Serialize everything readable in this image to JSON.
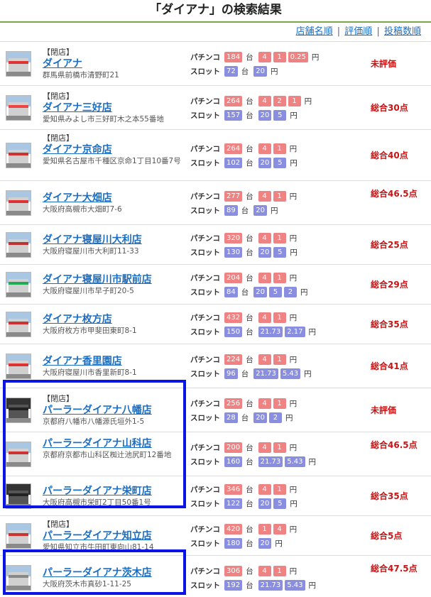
{
  "page_title": "「ダイアナ」の検索結果",
  "sort": {
    "by_name": "店舗名順",
    "by_rating": "評価順",
    "by_posts": "投稿数順",
    "separator": "|"
  },
  "labels": {
    "closed": "【閉店】",
    "pachinko": "パチンコ",
    "slot": "スロット",
    "dai": "台",
    "yen": "円"
  },
  "stores": [
    {
      "closed": true,
      "name": "ダイアナ",
      "address": "群馬県前橋市清野町21",
      "pachinko_count": "184",
      "pachinko_rates": [
        "4",
        "1",
        "0.25"
      ],
      "slot_count": "72",
      "slot_rates": [
        "20"
      ],
      "score": "未評価"
    },
    {
      "closed": true,
      "name": "ダイアナ三好店",
      "address": "愛知県みよし市三好町木之本55番地",
      "pachinko_count": "264",
      "pachinko_rates": [
        "4",
        "2",
        "1"
      ],
      "slot_count": "157",
      "slot_rates": [
        "20",
        "5"
      ],
      "score": "総合30点"
    },
    {
      "closed": true,
      "name": "ダイアナ京命店",
      "address": "愛知県名古屋市千種区京命1丁目10番7号",
      "pachinko_count": "264",
      "pachinko_rates": [
        "4",
        "1"
      ],
      "slot_count": "102",
      "slot_rates": [
        "20",
        "5"
      ],
      "score": "総合40点"
    },
    {
      "closed": false,
      "name": "ダイアナ大畑店",
      "address": "大阪府高槻市大畑町7-6",
      "pachinko_count": "277",
      "pachinko_rates": [
        "4",
        "1"
      ],
      "slot_count": "89",
      "slot_rates": [
        "20"
      ],
      "score": "総合46.5点"
    },
    {
      "closed": false,
      "name": "ダイアナ寝屋川大利店",
      "address": "大阪府寝屋川市大利町11-33",
      "pachinko_count": "320",
      "pachinko_rates": [
        "4",
        "1"
      ],
      "slot_count": "130",
      "slot_rates": [
        "20",
        "5"
      ],
      "score": "総合25点"
    },
    {
      "closed": false,
      "name": "ダイアナ寝屋川市駅前店",
      "address": "大阪府寝屋川市早子町20-5",
      "pachinko_count": "204",
      "pachinko_rates": [
        "4",
        "1"
      ],
      "slot_count": "84",
      "slot_rates": [
        "20",
        "5",
        "2"
      ],
      "score": "総合29点"
    },
    {
      "closed": false,
      "name": "ダイアナ枚方店",
      "address": "大阪府枚方市甲斐田東町8-1",
      "pachinko_count": "432",
      "pachinko_rates": [
        "4",
        "1"
      ],
      "slot_count": "150",
      "slot_rates": [
        "21.73",
        "2.17"
      ],
      "score": "総合35点"
    },
    {
      "closed": false,
      "name": "ダイアナ香里園店",
      "address": "大阪府寝屋川市香里新町8-1",
      "pachinko_count": "224",
      "pachinko_rates": [
        "4",
        "1"
      ],
      "slot_count": "96",
      "slot_rates": [
        "21.73",
        "5.43"
      ],
      "score": "総合41点"
    },
    {
      "closed": true,
      "name": "パーラーダイアナ八幡店",
      "address": "京都府八幡市八幡源氏垣外1-5",
      "pachinko_count": "256",
      "pachinko_rates": [
        "4",
        "1"
      ],
      "slot_count": "28",
      "slot_rates": [
        "20",
        "2"
      ],
      "score": "未評価"
    },
    {
      "closed": false,
      "name": "パーラーダイアナ山科店",
      "address": "京都府京都市山科区椥辻池尻町12番地",
      "pachinko_count": "200",
      "pachinko_rates": [
        "4",
        "1"
      ],
      "slot_count": "160",
      "slot_rates": [
        "21.73",
        "5.43"
      ],
      "score": "総合46.5点"
    },
    {
      "closed": false,
      "name": "パーラーダイアナ栄町店",
      "address": "大阪府高槻市栄町2丁目50番1号",
      "pachinko_count": "346",
      "pachinko_rates": [
        "4",
        "1"
      ],
      "slot_count": "122",
      "slot_rates": [
        "20",
        "5"
      ],
      "score": "総合35点"
    },
    {
      "closed": true,
      "name": "パーラーダイアナ知立店",
      "address": "愛知県知立市牛田町東向山81-14",
      "pachinko_count": "420",
      "pachinko_rates": [
        "1",
        "4"
      ],
      "slot_count": "180",
      "slot_rates": [
        "20"
      ],
      "score": "総合5点"
    },
    {
      "closed": false,
      "name": "パーラーダイアナ茨木店",
      "address": "大阪府茨木市真砂1-11-25",
      "pachinko_count": "306",
      "pachinko_rates": [
        "4",
        "1"
      ],
      "slot_count": "192",
      "slot_rates": [
        "21.73",
        "5.43"
      ],
      "score": "総合47.5点"
    }
  ],
  "colors": {
    "accent_line": "#7da848",
    "link": "#1b6ec2",
    "score": "#c81414",
    "pachinko_chip": "#ef8282",
    "slot_chip": "#8a8ee0",
    "highlight": "#0a14e6"
  }
}
